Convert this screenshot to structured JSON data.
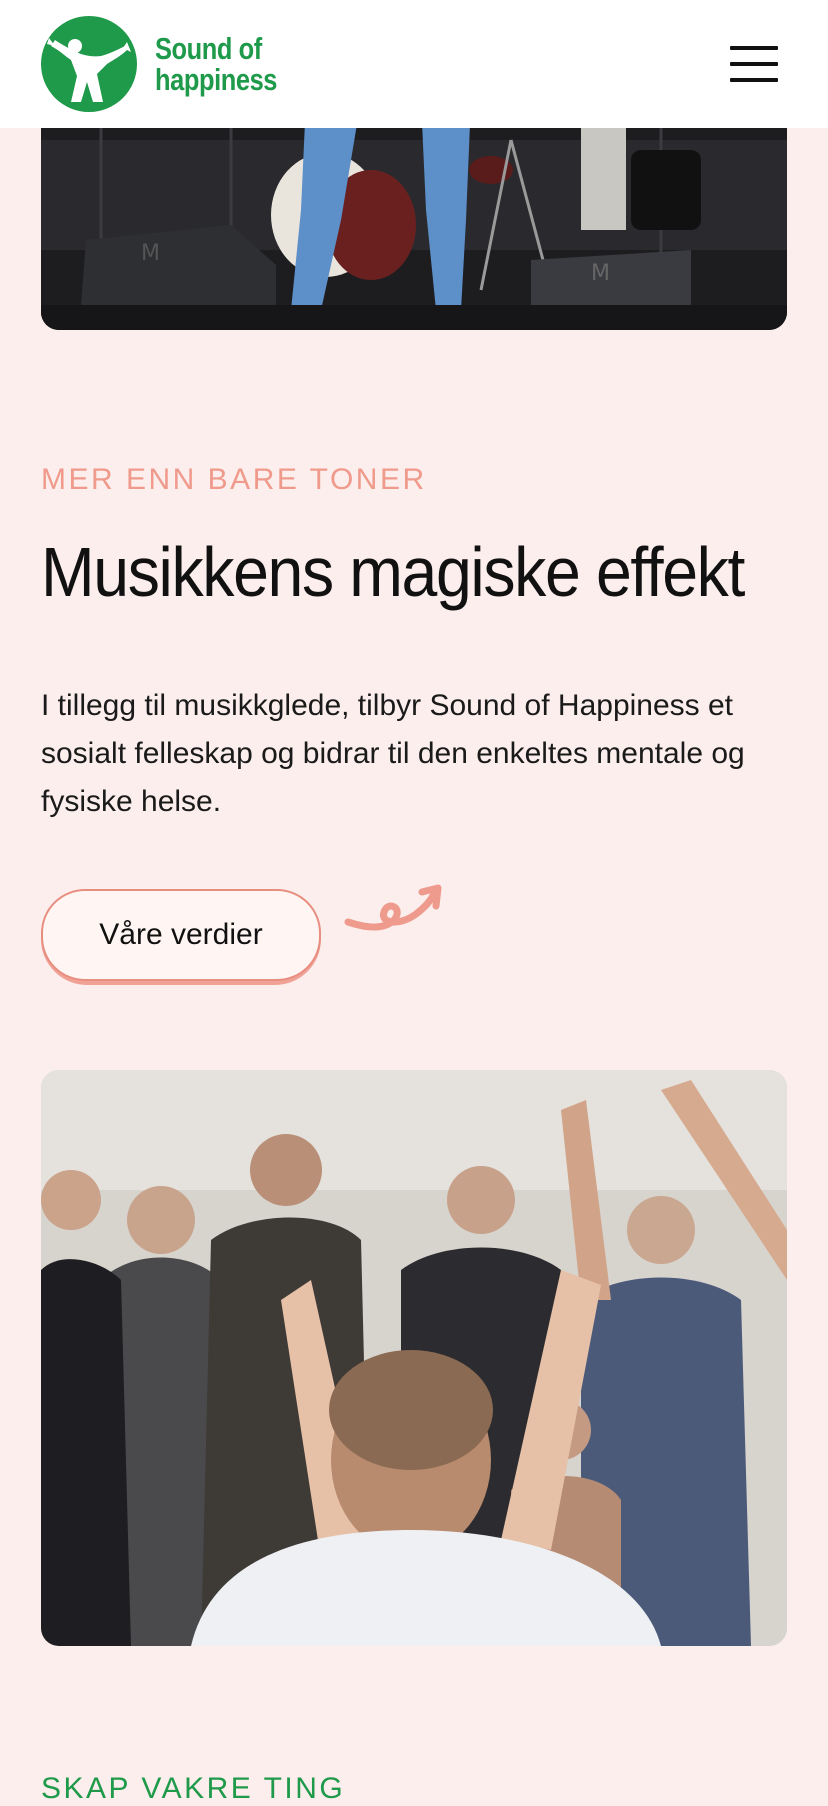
{
  "header": {
    "logo": {
      "line1": "Sound of",
      "line2": "happiness"
    },
    "menu_icon": "hamburger-menu-icon"
  },
  "section": {
    "eyebrow": "MER ENN BARE TONER",
    "title": "Musikkens magiske effekt",
    "body": "I tillegg til musikkglede, tilbyr Sound of Happiness et sosialt felleskap og bidrar til den enkeltes mentale og fysiske helse.",
    "button_label": "Våre verdier",
    "decoration_icon": "swirl-arrow-icon"
  },
  "next_section": {
    "eyebrow": "SKAP VAKRE TING"
  },
  "colors": {
    "brand_green": "#1f9a4a",
    "accent_salmon": "#f09a8c",
    "page_background": "#fbeeec"
  }
}
